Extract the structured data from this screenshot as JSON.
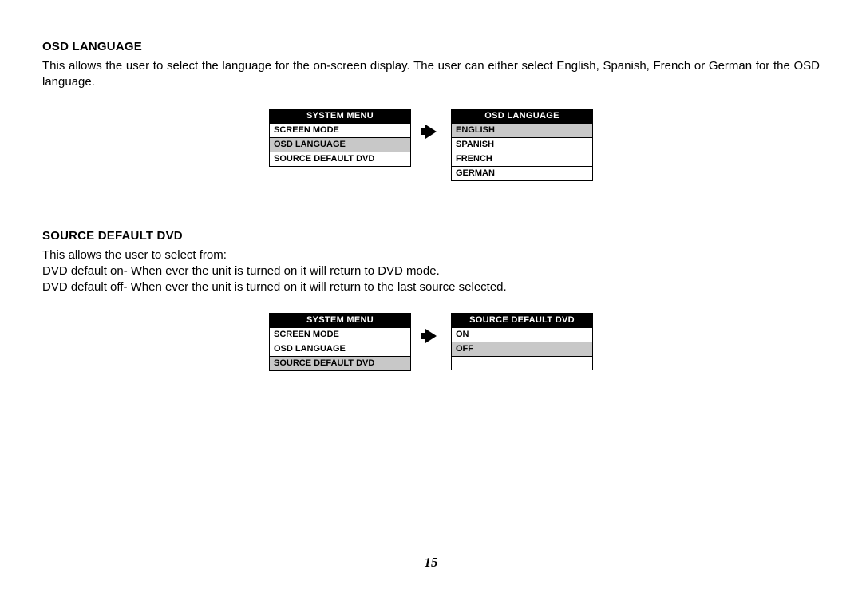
{
  "page_number": "15",
  "sections": {
    "osd_language": {
      "heading": "Osd Language",
      "paragraph": "This allows the user to select the language for the on-screen display. The user can either select English, Spanish, French or German for the OSD language.",
      "left_menu": {
        "header": "SYSTEM MENU",
        "items": [
          {
            "label": "SCREEN MODE",
            "selected": false
          },
          {
            "label": "OSD LANGUAGE",
            "selected": true
          },
          {
            "label": "SOURCE DEFAULT DVD",
            "selected": false
          }
        ]
      },
      "right_menu": {
        "header": "OSD LANGUAGE",
        "items": [
          {
            "label": "ENGLISH",
            "selected": true
          },
          {
            "label": "SPANISH",
            "selected": false
          },
          {
            "label": "FRENCH",
            "selected": false
          },
          {
            "label": "GERMAN",
            "selected": false
          }
        ]
      }
    },
    "source_default": {
      "heading": "SOURCE DEFAULT DVD",
      "line1": "This allows the user to select from:",
      "line2": "DVD default on-  When ever the unit is turned on it will return to DVD mode.",
      "line3": "DVD default off-  When ever the unit is turned on it will return to the last source selected.",
      "left_menu": {
        "header": "SYSTEM MENU",
        "items": [
          {
            "label": "SCREEN MODE",
            "selected": false
          },
          {
            "label": "OSD LANGUAGE",
            "selected": false
          },
          {
            "label": "SOURCE DEFAULT DVD",
            "selected": true
          }
        ]
      },
      "right_menu": {
        "header": "SOURCE DEFAULT DVD",
        "items": [
          {
            "label": "ON",
            "selected": false
          },
          {
            "label": "OFF",
            "selected": true
          },
          {
            "label": "",
            "selected": false
          }
        ]
      }
    }
  }
}
